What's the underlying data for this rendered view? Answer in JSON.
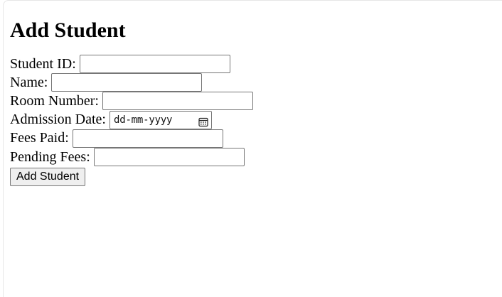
{
  "form": {
    "title": "Add Student",
    "fields": {
      "student_id": {
        "label": "Student ID:",
        "value": ""
      },
      "name": {
        "label": "Name:",
        "value": ""
      },
      "room_number": {
        "label": "Room Number:",
        "value": ""
      },
      "admission_date": {
        "label": "Admission Date:",
        "placeholder": "dd-mm-yyyy",
        "icon": "calendar-icon"
      },
      "fees_paid": {
        "label": "Fees Paid:",
        "value": ""
      },
      "pending_fees": {
        "label": "Pending Fees:",
        "value": ""
      }
    },
    "submit_label": "Add Student"
  }
}
